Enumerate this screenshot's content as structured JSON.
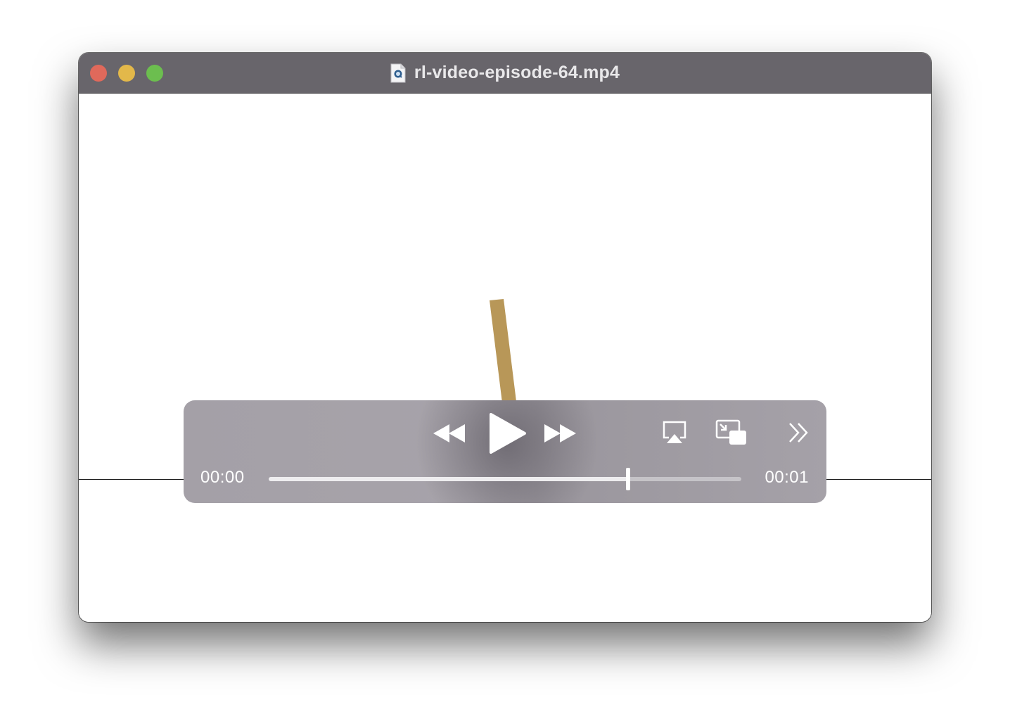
{
  "window": {
    "title": "rl-video-episode-64.mp4",
    "file_icon": "quicktime-document-icon"
  },
  "window_buttons": {
    "close_color": "#e0695b",
    "minimize_color": "#e3b84a",
    "zoom_color": "#6cbe4f"
  },
  "video": {
    "pole_color": "#b89758",
    "ground_line_color": "#1a1a1a"
  },
  "controls": {
    "rewind_icon": "rewind-icon",
    "play_icon": "play-icon",
    "fast_forward_icon": "fast-forward-icon",
    "airplay_icon": "airplay-icon",
    "picture_in_picture_icon": "picture-in-picture-icon",
    "more_icon": "chevron-double-right-icon",
    "current_time": "00:00",
    "duration": "00:01",
    "progress": 0.76
  }
}
